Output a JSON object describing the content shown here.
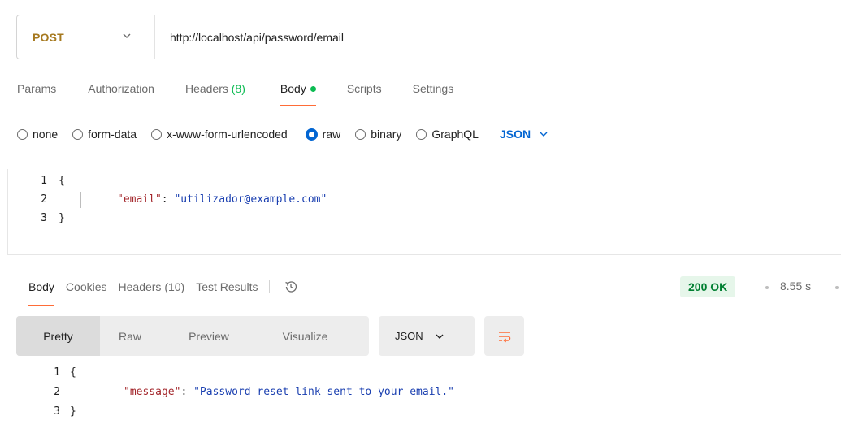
{
  "request": {
    "method": "POST",
    "url": "http://localhost/api/password/email"
  },
  "request_tabs": [
    {
      "label": "Params"
    },
    {
      "label": "Authorization"
    },
    {
      "label": "Headers",
      "count": "(8)"
    },
    {
      "label": "Body"
    },
    {
      "label": "Scripts"
    },
    {
      "label": "Settings"
    }
  ],
  "body_types": {
    "none": "none",
    "form_data": "form-data",
    "urlencoded": "x-www-form-urlencoded",
    "raw": "raw",
    "binary": "binary",
    "graphql": "GraphQL",
    "language": "JSON",
    "selected": "raw"
  },
  "request_body": {
    "line_numbers": [
      "1",
      "2",
      "3"
    ],
    "open_brace": "{",
    "key": "\"email\"",
    "colon": ": ",
    "value": "\"utilizador@example.com\"",
    "close_brace": "}"
  },
  "response_tabs": [
    {
      "label": "Body"
    },
    {
      "label": "Cookies"
    },
    {
      "label": "Headers (10)"
    },
    {
      "label": "Test Results"
    }
  ],
  "response_status": {
    "status": "200 OK",
    "time": "8.55 s"
  },
  "response_views": {
    "pretty": "Pretty",
    "raw": "Raw",
    "preview": "Preview",
    "visualize": "Visualize",
    "format": "JSON"
  },
  "response_body": {
    "line_numbers": [
      "1",
      "2",
      "3"
    ],
    "open_brace": "{",
    "key": "\"message\"",
    "colon": ": ",
    "value": "\"Password reset link sent to your email.\"",
    "close_brace": "}"
  },
  "colors": {
    "method": "#a6791f",
    "accent": "#ff6c37",
    "link": "#0265d2",
    "success": "#0cbb52",
    "status_ok": "#007f31"
  },
  "icons": {
    "method_dropdown": "chevron-down-icon",
    "language_dropdown": "chevron-down-icon",
    "history": "history-icon",
    "format_dropdown": "chevron-down-icon",
    "wrap": "wrap-lines-icon"
  }
}
